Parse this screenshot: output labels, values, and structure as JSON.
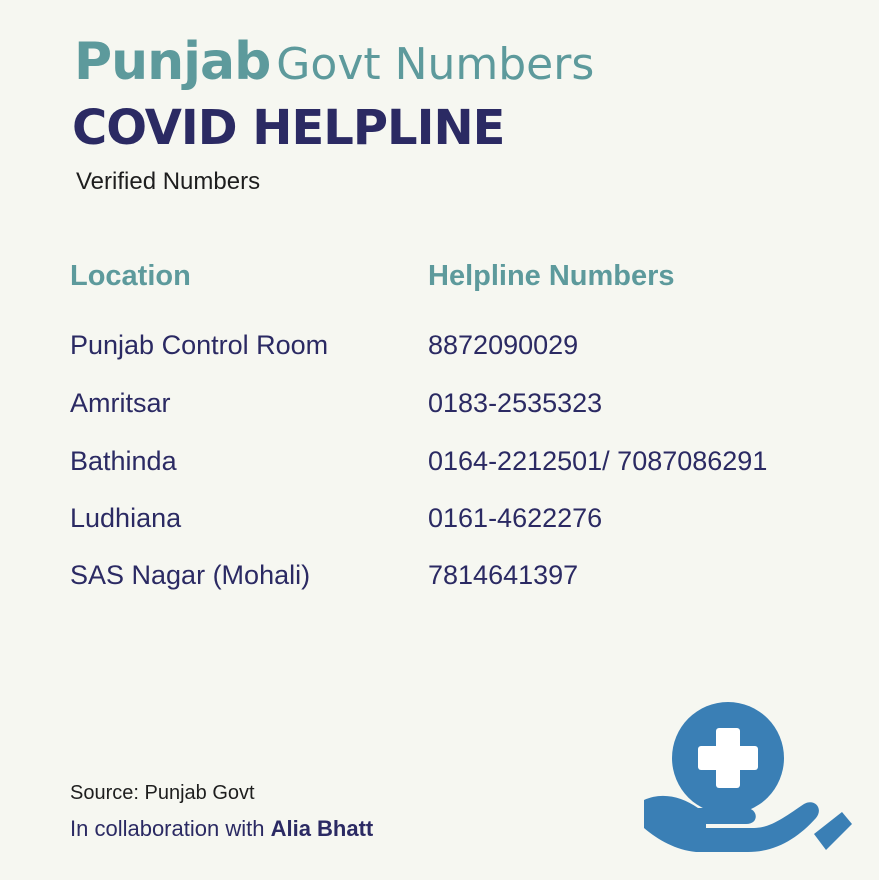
{
  "header": {
    "title_bold": "Punjab",
    "title_regular": "Govt Numbers",
    "headline": "COVID HELPLINE",
    "subtitle": "Verified Numbers"
  },
  "table": {
    "columns": [
      "Location",
      "Helpline Numbers"
    ],
    "rows": [
      {
        "location": "Punjab Control Room",
        "number": "8872090029"
      },
      {
        "location": "Amritsar",
        "number": "0183-2535323"
      },
      {
        "location": "Bathinda",
        "number": "0164-2212501/ 7087086291"
      },
      {
        "location": "Ludhiana",
        "number": "0161-4622276"
      },
      {
        "location": "SAS Nagar (Mohali)",
        "number": "7814641397"
      }
    ]
  },
  "footer": {
    "source": "Source: Punjab Govt",
    "collab_prefix": "In collaboration with",
    "collab_name": "Alia Bhatt"
  },
  "icons": {
    "illustration": "hand-holding-medical-cross-icon"
  },
  "colors": {
    "background": "#f6f7f1",
    "teal": "#5d9a9c",
    "navy": "#2b2a63",
    "icon_blue": "#3a7fb5"
  }
}
